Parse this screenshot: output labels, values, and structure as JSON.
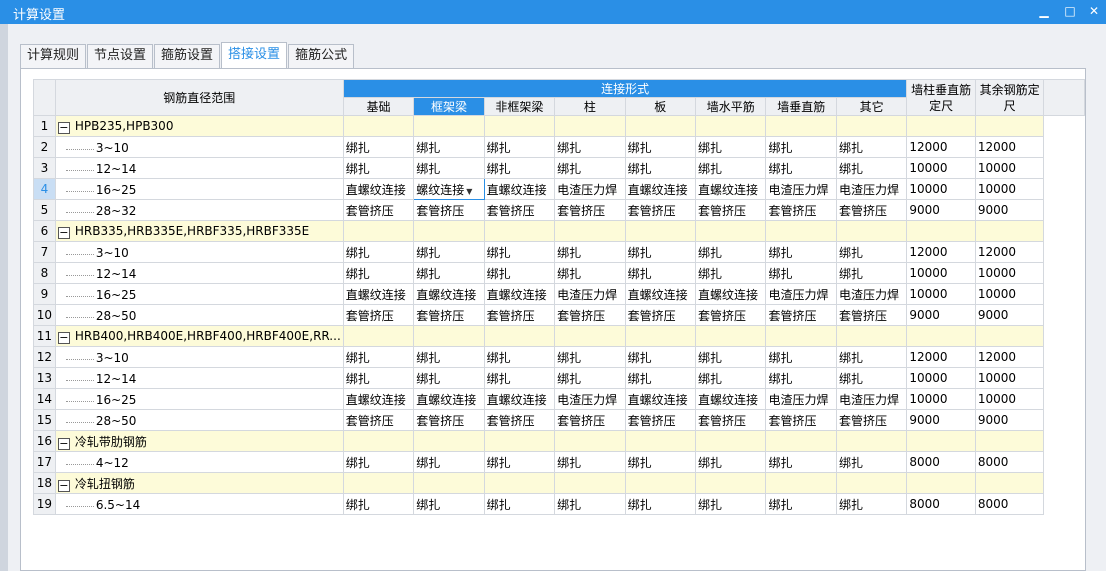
{
  "window": {
    "title": "计算设置"
  },
  "tabs": [
    "计算规则",
    "节点设置",
    "箍筋设置",
    "搭接设置",
    "箍筋公式"
  ],
  "active_tab": "搭接设置",
  "table": {
    "col_range": "钢筋直径范围",
    "group_header": "连接形式",
    "sub_headers": [
      "基础",
      "框架梁",
      "非框架梁",
      "柱",
      "板",
      "墙水平筋",
      "墙垂直筋",
      "其它"
    ],
    "col_wall": "墙柱垂直筋定尺",
    "col_other": "其余钢筋定尺",
    "rows": [
      {
        "n": "1",
        "type": "group",
        "name": "HPB235,HPB300",
        "cells": [
          "",
          "",
          "",
          "",
          "",
          "",
          "",
          "",
          "",
          ""
        ]
      },
      {
        "n": "2",
        "type": "item",
        "name": "3~10",
        "cells": [
          "绑扎",
          "绑扎",
          "绑扎",
          "绑扎",
          "绑扎",
          "绑扎",
          "绑扎",
          "绑扎",
          "12000",
          "12000"
        ]
      },
      {
        "n": "3",
        "type": "item",
        "name": "12~14",
        "cells": [
          "绑扎",
          "绑扎",
          "绑扎",
          "绑扎",
          "绑扎",
          "绑扎",
          "绑扎",
          "绑扎",
          "10000",
          "10000"
        ]
      },
      {
        "n": "4",
        "type": "item",
        "name": "16~25",
        "cells": [
          "直螺纹连接",
          "螺纹连接",
          "直螺纹连接",
          "电渣压力焊",
          "直螺纹连接",
          "直螺纹连接",
          "电渣压力焊",
          "电渣压力焊",
          "10000",
          "10000"
        ]
      },
      {
        "n": "5",
        "type": "item",
        "name": "28~32",
        "cells": [
          "套管挤压",
          "套管挤压",
          "套管挤压",
          "套管挤压",
          "套管挤压",
          "套管挤压",
          "套管挤压",
          "套管挤压",
          "9000",
          "9000"
        ]
      },
      {
        "n": "6",
        "type": "group",
        "name": "HRB335,HRB335E,HRBF335,HRBF335E",
        "cells": [
          "",
          "",
          "",
          "",
          "",
          "",
          "",
          "",
          "",
          ""
        ]
      },
      {
        "n": "7",
        "type": "item",
        "name": "3~10",
        "cells": [
          "绑扎",
          "绑扎",
          "绑扎",
          "绑扎",
          "绑扎",
          "绑扎",
          "绑扎",
          "绑扎",
          "12000",
          "12000"
        ]
      },
      {
        "n": "8",
        "type": "item",
        "name": "12~14",
        "cells": [
          "绑扎",
          "绑扎",
          "绑扎",
          "绑扎",
          "绑扎",
          "绑扎",
          "绑扎",
          "绑扎",
          "10000",
          "10000"
        ]
      },
      {
        "n": "9",
        "type": "item",
        "name": "16~25",
        "cells": [
          "直螺纹连接",
          "直螺纹连接",
          "直螺纹连接",
          "电渣压力焊",
          "直螺纹连接",
          "直螺纹连接",
          "电渣压力焊",
          "电渣压力焊",
          "10000",
          "10000"
        ]
      },
      {
        "n": "10",
        "type": "item",
        "name": "28~50",
        "cells": [
          "套管挤压",
          "套管挤压",
          "套管挤压",
          "套管挤压",
          "套管挤压",
          "套管挤压",
          "套管挤压",
          "套管挤压",
          "9000",
          "9000"
        ]
      },
      {
        "n": "11",
        "type": "group",
        "name": "HRB400,HRB400E,HRBF400,HRBF400E,RR...",
        "cells": [
          "",
          "",
          "",
          "",
          "",
          "",
          "",
          "",
          "",
          ""
        ]
      },
      {
        "n": "12",
        "type": "item",
        "name": "3~10",
        "cells": [
          "绑扎",
          "绑扎",
          "绑扎",
          "绑扎",
          "绑扎",
          "绑扎",
          "绑扎",
          "绑扎",
          "12000",
          "12000"
        ]
      },
      {
        "n": "13",
        "type": "item",
        "name": "12~14",
        "cells": [
          "绑扎",
          "绑扎",
          "绑扎",
          "绑扎",
          "绑扎",
          "绑扎",
          "绑扎",
          "绑扎",
          "10000",
          "10000"
        ]
      },
      {
        "n": "14",
        "type": "item",
        "name": "16~25",
        "cells": [
          "直螺纹连接",
          "直螺纹连接",
          "直螺纹连接",
          "电渣压力焊",
          "直螺纹连接",
          "直螺纹连接",
          "电渣压力焊",
          "电渣压力焊",
          "10000",
          "10000"
        ]
      },
      {
        "n": "15",
        "type": "item",
        "name": "28~50",
        "cells": [
          "套管挤压",
          "套管挤压",
          "套管挤压",
          "套管挤压",
          "套管挤压",
          "套管挤压",
          "套管挤压",
          "套管挤压",
          "9000",
          "9000"
        ]
      },
      {
        "n": "16",
        "type": "group",
        "name": "冷轧带肋钢筋",
        "cells": [
          "",
          "",
          "",
          "",
          "",
          "",
          "",
          "",
          "",
          ""
        ]
      },
      {
        "n": "17",
        "type": "item",
        "name": "4~12",
        "cells": [
          "绑扎",
          "绑扎",
          "绑扎",
          "绑扎",
          "绑扎",
          "绑扎",
          "绑扎",
          "绑扎",
          "8000",
          "8000"
        ]
      },
      {
        "n": "18",
        "type": "group",
        "name": "冷轧扭钢筋",
        "cells": [
          "",
          "",
          "",
          "",
          "",
          "",
          "",
          "",
          "",
          ""
        ]
      },
      {
        "n": "19",
        "type": "item",
        "name": "6.5~14",
        "cells": [
          "绑扎",
          "绑扎",
          "绑扎",
          "绑扎",
          "绑扎",
          "绑扎",
          "绑扎",
          "绑扎",
          "8000",
          "8000"
        ]
      }
    ]
  },
  "selection": {
    "row": "4",
    "column": "框架梁"
  },
  "colors": {
    "title_bar": "#2a8fe6",
    "header_band": "#2a8fe6",
    "group_row": "#fdfbd9"
  }
}
